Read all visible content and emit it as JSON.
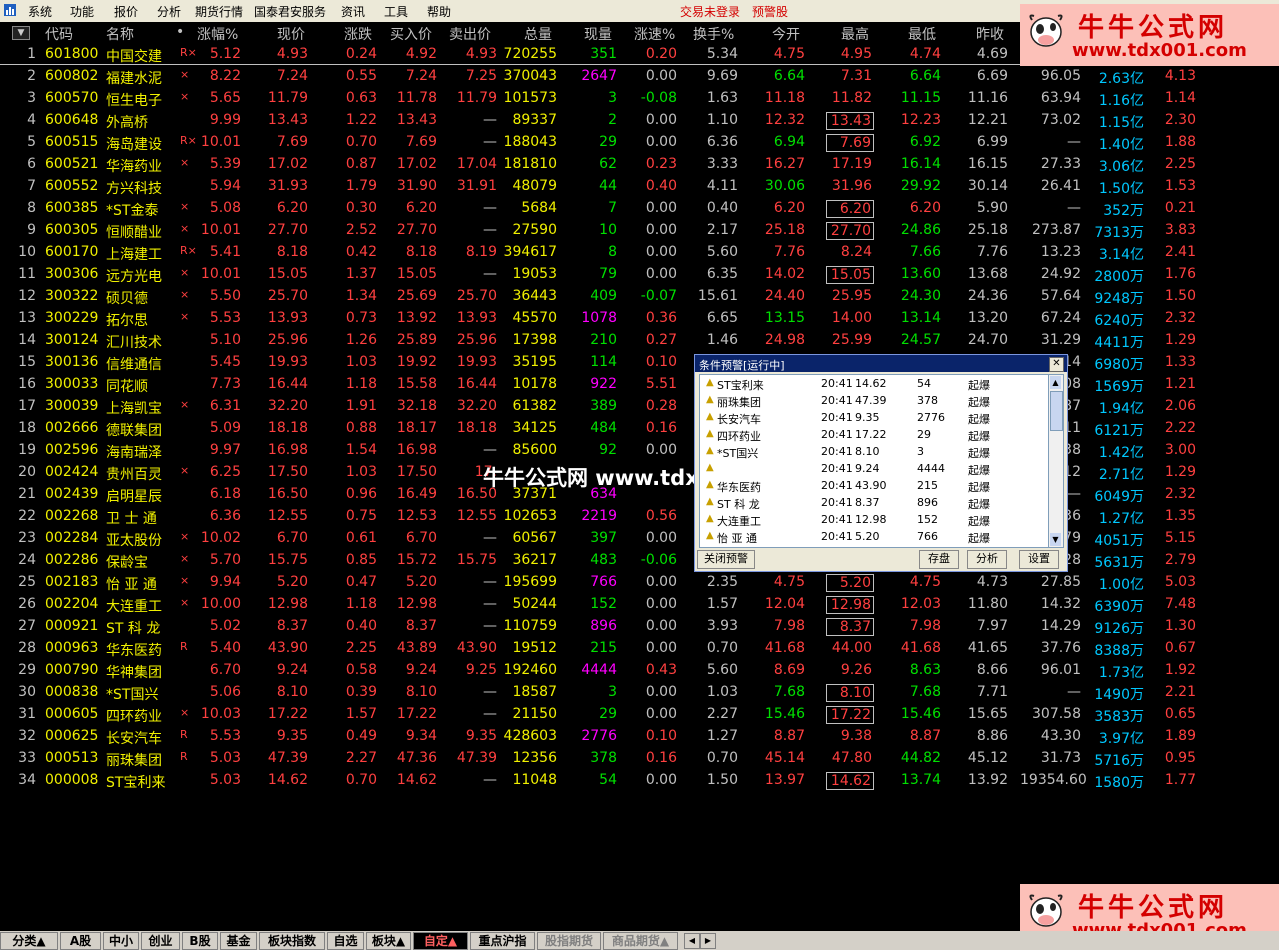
{
  "menu": {
    "items": [
      "系统",
      "功能",
      "报价",
      "分析",
      "期货行情",
      "国泰君安服务",
      "资讯",
      "工具",
      "帮助"
    ],
    "status": "交易未登录",
    "alert_stock": "预警股"
  },
  "header": [
    "代码",
    "名称",
    "•",
    "涨幅%",
    "现价",
    "涨跌",
    "买入价",
    "卖出价",
    "总量",
    "现量",
    "涨速%",
    "换手%",
    "今开",
    "最高",
    "最低",
    "昨收"
  ],
  "colors": {
    "up": "#ff4040",
    "down": "#00e000",
    "flat": "#c0c0c0",
    "code": "#f0f000",
    "name": "#f0f000",
    "vol": "#f0f000",
    "cur_up": "#ff00ff",
    "cur_down": "#00e000"
  },
  "rows": [
    {
      "n": "1",
      "code": "601800",
      "name": "中国交建",
      "flag": "R×",
      "pct": "5.12",
      "price": "4.93",
      "chg": "0.24",
      "bid": "4.92",
      "ask": "4.93",
      "vol": "720255",
      "cur": "351",
      "spd": "0.20",
      "turn": "5.34",
      "open": "4.75",
      "high": "4.95",
      "low": "4.74",
      "prev": "4.69",
      "e1": "",
      "e2": "",
      "e3": "",
      "hbox": false
    },
    {
      "n": "2",
      "code": "600802",
      "name": "福建水泥",
      "flag": "×",
      "pct": "8.22",
      "price": "7.24",
      "chg": "0.55",
      "bid": "7.24",
      "ask": "7.25",
      "vol": "370043",
      "cur": "2647",
      "spd": "0.00",
      "turn": "9.69",
      "open": "6.64",
      "high": "7.31",
      "low": "6.64",
      "prev": "6.69",
      "e1": "96.05",
      "e2": "2.63亿",
      "e3": "4.13",
      "hbox": false
    },
    {
      "n": "3",
      "code": "600570",
      "name": "恒生电子",
      "flag": "×",
      "pct": "5.65",
      "price": "11.79",
      "chg": "0.63",
      "bid": "11.78",
      "ask": "11.79",
      "vol": "101573",
      "cur": "3",
      "spd": "-0.08",
      "turn": "1.63",
      "open": "11.18",
      "high": "11.82",
      "low": "11.15",
      "prev": "11.16",
      "e1": "63.94",
      "e2": "1.16亿",
      "e3": "1.14",
      "hbox": false
    },
    {
      "n": "4",
      "code": "600648",
      "name": "外高桥",
      "flag": "",
      "pct": "9.99",
      "price": "13.43",
      "chg": "1.22",
      "bid": "13.43",
      "ask": "—",
      "vol": "89337",
      "cur": "2",
      "spd": "0.00",
      "turn": "1.10",
      "open": "12.32",
      "high": "13.43",
      "low": "12.23",
      "prev": "12.21",
      "e1": "73.02",
      "e2": "1.15亿",
      "e3": "2.30",
      "hbox": true
    },
    {
      "n": "5",
      "code": "600515",
      "name": "海岛建设",
      "flag": "R×",
      "pct": "10.01",
      "price": "7.69",
      "chg": "0.70",
      "bid": "7.69",
      "ask": "—",
      "vol": "188043",
      "cur": "29",
      "spd": "0.00",
      "turn": "6.36",
      "open": "6.94",
      "high": "7.69",
      "low": "6.92",
      "prev": "6.99",
      "e1": "—",
      "e2": "1.40亿",
      "e3": "1.88",
      "hbox": true
    },
    {
      "n": "6",
      "code": "600521",
      "name": "华海药业",
      "flag": "×",
      "pct": "5.39",
      "price": "17.02",
      "chg": "0.87",
      "bid": "17.02",
      "ask": "17.04",
      "vol": "181810",
      "cur": "62",
      "spd": "0.23",
      "turn": "3.33",
      "open": "16.27",
      "high": "17.19",
      "low": "16.14",
      "prev": "16.15",
      "e1": "27.33",
      "e2": "3.06亿",
      "e3": "2.25",
      "hbox": false
    },
    {
      "n": "7",
      "code": "600552",
      "name": "方兴科技",
      "flag": "",
      "pct": "5.94",
      "price": "31.93",
      "chg": "1.79",
      "bid": "31.90",
      "ask": "31.91",
      "vol": "48079",
      "cur": "44",
      "spd": "0.40",
      "turn": "4.11",
      "open": "30.06",
      "high": "31.96",
      "low": "29.92",
      "prev": "30.14",
      "e1": "26.41",
      "e2": "1.50亿",
      "e3": "1.53",
      "hbox": false
    },
    {
      "n": "8",
      "code": "600385",
      "name": "*ST金泰",
      "flag": "×",
      "pct": "5.08",
      "price": "6.20",
      "chg": "0.30",
      "bid": "6.20",
      "ask": "—",
      "vol": "5684",
      "cur": "7",
      "spd": "0.00",
      "turn": "0.40",
      "open": "6.20",
      "high": "6.20",
      "low": "6.20",
      "prev": "5.90",
      "e1": "—",
      "e2": "352万",
      "e3": "0.21",
      "hbox": true
    },
    {
      "n": "9",
      "code": "600305",
      "name": "恒顺醋业",
      "flag": "×",
      "pct": "10.01",
      "price": "27.70",
      "chg": "2.52",
      "bid": "27.70",
      "ask": "—",
      "vol": "27590",
      "cur": "10",
      "spd": "0.00",
      "turn": "2.17",
      "open": "25.18",
      "high": "27.70",
      "low": "24.86",
      "prev": "25.18",
      "e1": "273.87",
      "e2": "7313万",
      "e3": "3.83",
      "hbox": true
    },
    {
      "n": "10",
      "code": "600170",
      "name": "上海建工",
      "flag": "R×",
      "pct": "5.41",
      "price": "8.18",
      "chg": "0.42",
      "bid": "8.18",
      "ask": "8.19",
      "vol": "394617",
      "cur": "8",
      "spd": "0.00",
      "turn": "5.60",
      "open": "7.76",
      "high": "8.24",
      "low": "7.66",
      "prev": "7.76",
      "e1": "13.23",
      "e2": "3.14亿",
      "e3": "2.41",
      "hbox": false
    },
    {
      "n": "11",
      "code": "300306",
      "name": "远方光电",
      "flag": "×",
      "pct": "10.01",
      "price": "15.05",
      "chg": "1.37",
      "bid": "15.05",
      "ask": "—",
      "vol": "19053",
      "cur": "79",
      "spd": "0.00",
      "turn": "6.35",
      "open": "14.02",
      "high": "15.05",
      "low": "13.60",
      "prev": "13.68",
      "e1": "24.92",
      "e2": "2800万",
      "e3": "1.76",
      "hbox": true
    },
    {
      "n": "12",
      "code": "300322",
      "name": "硕贝德",
      "flag": "×",
      "pct": "5.50",
      "price": "25.70",
      "chg": "1.34",
      "bid": "25.69",
      "ask": "25.70",
      "vol": "36443",
      "cur": "409",
      "spd": "-0.07",
      "turn": "15.61",
      "open": "24.40",
      "high": "25.95",
      "low": "24.30",
      "prev": "24.36",
      "e1": "57.64",
      "e2": "9248万",
      "e3": "1.50",
      "hbox": false
    },
    {
      "n": "13",
      "code": "300229",
      "name": "拓尔思",
      "flag": "×",
      "pct": "5.53",
      "price": "13.93",
      "chg": "0.73",
      "bid": "13.92",
      "ask": "13.93",
      "vol": "45570",
      "cur": "1078",
      "spd": "0.36",
      "turn": "6.65",
      "open": "13.15",
      "high": "14.00",
      "low": "13.14",
      "prev": "13.20",
      "e1": "67.24",
      "e2": "6240万",
      "e3": "2.32",
      "hbox": false
    },
    {
      "n": "14",
      "code": "300124",
      "name": "汇川技术",
      "flag": "",
      "pct": "5.10",
      "price": "25.96",
      "chg": "1.26",
      "bid": "25.89",
      "ask": "25.96",
      "vol": "17398",
      "cur": "210",
      "spd": "0.27",
      "turn": "1.46",
      "open": "24.98",
      "high": "25.99",
      "low": "24.57",
      "prev": "24.70",
      "e1": "31.29",
      "e2": "4411万",
      "e3": "1.29",
      "hbox": false
    },
    {
      "n": "15",
      "code": "300136",
      "name": "信维通信",
      "flag": "",
      "pct": "5.45",
      "price": "19.93",
      "chg": "1.03",
      "bid": "19.92",
      "ask": "19.93",
      "vol": "35195",
      "cur": "114",
      "spd": "0.10",
      "turn": "",
      "open": "",
      "high": "",
      "low": "",
      "prev": "",
      "e1": "14",
      "e2": "6980万",
      "e3": "1.33",
      "hbox": false
    },
    {
      "n": "16",
      "code": "300033",
      "name": "同花顺",
      "flag": "",
      "pct": "7.73",
      "price": "16.44",
      "chg": "1.18",
      "bid": "15.58",
      "ask": "16.44",
      "vol": "10178",
      "cur": "922",
      "spd": "5.51",
      "turn": "",
      "open": "",
      "high": "",
      "low": "",
      "prev": "",
      "e1": "08",
      "e2": "1569万",
      "e3": "1.21",
      "hbox": false
    },
    {
      "n": "17",
      "code": "300039",
      "name": "上海凯宝",
      "flag": "×",
      "pct": "6.31",
      "price": "32.20",
      "chg": "1.91",
      "bid": "32.18",
      "ask": "32.20",
      "vol": "61382",
      "cur": "389",
      "spd": "0.28",
      "turn": "",
      "open": "",
      "high": "",
      "low": "",
      "prev": "",
      "e1": "87",
      "e2": "1.94亿",
      "e3": "2.06",
      "hbox": false
    },
    {
      "n": "18",
      "code": "002666",
      "name": "德联集团",
      "flag": "",
      "pct": "5.09",
      "price": "18.18",
      "chg": "0.88",
      "bid": "18.17",
      "ask": "18.18",
      "vol": "34125",
      "cur": "484",
      "spd": "0.16",
      "turn": "",
      "open": "",
      "high": "",
      "low": "",
      "prev": "",
      "e1": "11",
      "e2": "6121万",
      "e3": "2.22",
      "hbox": false
    },
    {
      "n": "19",
      "code": "002596",
      "name": "海南瑞泽",
      "flag": "",
      "pct": "9.97",
      "price": "16.98",
      "chg": "1.54",
      "bid": "16.98",
      "ask": "—",
      "vol": "85600",
      "cur": "92",
      "spd": "0.00",
      "turn": "",
      "open": "",
      "high": "",
      "low": "",
      "prev": "",
      "e1": "38",
      "e2": "1.42亿",
      "e3": "3.00",
      "hbox": false
    },
    {
      "n": "20",
      "code": "002424",
      "name": "贵州百灵",
      "flag": "×",
      "pct": "6.25",
      "price": "17.50",
      "chg": "1.03",
      "bid": "17.50",
      "ask": "17.",
      "vol": "",
      "cur": "",
      "spd": "",
      "turn": "",
      "open": "",
      "high": "",
      "low": "",
      "prev": "",
      "e1": "12",
      "e2": "2.71亿",
      "e3": "1.29",
      "hbox": false
    },
    {
      "n": "21",
      "code": "002439",
      "name": "启明星辰",
      "flag": "",
      "pct": "6.18",
      "price": "16.50",
      "chg": "0.96",
      "bid": "16.49",
      "ask": "16.50",
      "vol": "37371",
      "cur": "634",
      "spd": "",
      "turn": "",
      "open": "",
      "high": "",
      "low": "",
      "prev": "",
      "e1": "—",
      "e2": "6049万",
      "e3": "2.32",
      "hbox": false
    },
    {
      "n": "22",
      "code": "002268",
      "name": "卫 士 通",
      "flag": "",
      "pct": "6.36",
      "price": "12.55",
      "chg": "0.75",
      "bid": "12.53",
      "ask": "12.55",
      "vol": "102653",
      "cur": "2219",
      "spd": "0.56",
      "turn": "",
      "open": "",
      "high": "",
      "low": "",
      "prev": "",
      "e1": "36",
      "e2": "1.27亿",
      "e3": "1.35",
      "hbox": false
    },
    {
      "n": "23",
      "code": "002284",
      "name": "亚太股份",
      "flag": "×",
      "pct": "10.02",
      "price": "6.70",
      "chg": "0.61",
      "bid": "6.70",
      "ask": "—",
      "vol": "60567",
      "cur": "397",
      "spd": "0.00",
      "turn": "",
      "open": "",
      "high": "",
      "low": "",
      "prev": "",
      "e1": "79",
      "e2": "4051万",
      "e3": "5.15",
      "hbox": false
    },
    {
      "n": "24",
      "code": "002286",
      "name": "保龄宝",
      "flag": "×",
      "pct": "5.70",
      "price": "15.75",
      "chg": "0.85",
      "bid": "15.72",
      "ask": "15.75",
      "vol": "36217",
      "cur": "483",
      "spd": "-0.06",
      "turn": "",
      "open": "",
      "high": "",
      "low": "",
      "prev": "",
      "e1": "28",
      "e2": "5631万",
      "e3": "2.79",
      "hbox": false
    },
    {
      "n": "25",
      "code": "002183",
      "name": "怡 亚 通",
      "flag": "×",
      "pct": "9.94",
      "price": "5.20",
      "chg": "0.47",
      "bid": "5.20",
      "ask": "—",
      "vol": "195699",
      "cur": "766",
      "spd": "0.00",
      "turn": "2.35",
      "open": "4.75",
      "high": "5.20",
      "low": "4.75",
      "prev": "4.73",
      "e1": "27.85",
      "e2": "1.00亿",
      "e3": "5.03",
      "hbox": true
    },
    {
      "n": "26",
      "code": "002204",
      "name": "大连重工",
      "flag": "×",
      "pct": "10.00",
      "price": "12.98",
      "chg": "1.18",
      "bid": "12.98",
      "ask": "—",
      "vol": "50244",
      "cur": "152",
      "spd": "0.00",
      "turn": "1.57",
      "open": "12.04",
      "high": "12.98",
      "low": "12.03",
      "prev": "11.80",
      "e1": "14.32",
      "e2": "6390万",
      "e3": "7.48",
      "hbox": true
    },
    {
      "n": "27",
      "code": "000921",
      "name": "ST 科 龙",
      "flag": "",
      "pct": "5.02",
      "price": "8.37",
      "chg": "0.40",
      "bid": "8.37",
      "ask": "—",
      "vol": "110759",
      "cur": "896",
      "spd": "0.00",
      "turn": "3.93",
      "open": "7.98",
      "high": "8.37",
      "low": "7.98",
      "prev": "7.97",
      "e1": "14.29",
      "e2": "9126万",
      "e3": "1.30",
      "hbox": true
    },
    {
      "n": "28",
      "code": "000963",
      "name": "华东医药",
      "flag": "R",
      "pct": "5.40",
      "price": "43.90",
      "chg": "2.25",
      "bid": "43.89",
      "ask": "43.90",
      "vol": "19512",
      "cur": "215",
      "spd": "0.00",
      "turn": "0.70",
      "open": "41.68",
      "high": "44.00",
      "low": "41.68",
      "prev": "41.65",
      "e1": "37.76",
      "e2": "8388万",
      "e3": "0.67",
      "hbox": false
    },
    {
      "n": "29",
      "code": "000790",
      "name": "华神集团",
      "flag": "",
      "pct": "6.70",
      "price": "9.24",
      "chg": "0.58",
      "bid": "9.24",
      "ask": "9.25",
      "vol": "192460",
      "cur": "4444",
      "spd": "0.43",
      "turn": "5.60",
      "open": "8.69",
      "high": "9.26",
      "low": "8.63",
      "prev": "8.66",
      "e1": "96.01",
      "e2": "1.73亿",
      "e3": "1.92",
      "hbox": false
    },
    {
      "n": "30",
      "code": "000838",
      "name": "*ST国兴",
      "flag": "",
      "pct": "5.06",
      "price": "8.10",
      "chg": "0.39",
      "bid": "8.10",
      "ask": "—",
      "vol": "18587",
      "cur": "3",
      "spd": "0.00",
      "turn": "1.03",
      "open": "7.68",
      "high": "8.10",
      "low": "7.68",
      "prev": "7.71",
      "e1": "—",
      "e2": "1490万",
      "e3": "2.21",
      "hbox": true
    },
    {
      "n": "31",
      "code": "000605",
      "name": "四环药业",
      "flag": "×",
      "pct": "10.03",
      "price": "17.22",
      "chg": "1.57",
      "bid": "17.22",
      "ask": "—",
      "vol": "21150",
      "cur": "29",
      "spd": "0.00",
      "turn": "2.27",
      "open": "15.46",
      "high": "17.22",
      "low": "15.46",
      "prev": "15.65",
      "e1": "307.58",
      "e2": "3583万",
      "e3": "0.65",
      "hbox": true
    },
    {
      "n": "32",
      "code": "000625",
      "name": "长安汽车",
      "flag": "R",
      "pct": "5.53",
      "price": "9.35",
      "chg": "0.49",
      "bid": "9.34",
      "ask": "9.35",
      "vol": "428603",
      "cur": "2776",
      "spd": "0.10",
      "turn": "1.27",
      "open": "8.87",
      "high": "9.38",
      "low": "8.87",
      "prev": "8.86",
      "e1": "43.30",
      "e2": "3.97亿",
      "e3": "1.89",
      "hbox": false
    },
    {
      "n": "33",
      "code": "000513",
      "name": "丽珠集团",
      "flag": "R",
      "pct": "5.03",
      "price": "47.39",
      "chg": "2.27",
      "bid": "47.36",
      "ask": "47.39",
      "vol": "12356",
      "cur": "378",
      "spd": "0.16",
      "turn": "0.70",
      "open": "45.14",
      "high": "47.80",
      "low": "44.82",
      "prev": "45.12",
      "e1": "31.73",
      "e2": "5716万",
      "e3": "0.95",
      "hbox": false
    },
    {
      "n": "34",
      "code": "000008",
      "name": "ST宝利来",
      "flag": "",
      "pct": "5.03",
      "price": "14.62",
      "chg": "0.70",
      "bid": "14.62",
      "ask": "—",
      "vol": "11048",
      "cur": "54",
      "spd": "0.00",
      "turn": "1.50",
      "open": "13.97",
      "high": "14.62",
      "low": "13.74",
      "prev": "13.92",
      "e1": "19354.60",
      "e2": "1580万",
      "e3": "1.77",
      "hbox": true
    }
  ],
  "logo": {
    "t1": "牛牛公式网",
    "t2": "www.tdx001.com"
  },
  "watermark": "牛牛公式网 www.tdx001.com",
  "alert": {
    "title": "条件预警[运行中]",
    "rows": [
      {
        "name": "ST宝利来",
        "time": "20:41",
        "price": "14.62",
        "vol": "54",
        "type": "起爆"
      },
      {
        "name": "丽珠集团",
        "time": "20:41",
        "price": "47.39",
        "vol": "378",
        "type": "起爆"
      },
      {
        "name": "长安汽车",
        "time": "20:41",
        "price": "9.35",
        "vol": "2776",
        "type": "起爆"
      },
      {
        "name": "四环药业",
        "time": "20:41",
        "price": "17.22",
        "vol": "29",
        "type": "起爆"
      },
      {
        "name": "*ST国兴",
        "time": "20:41",
        "price": "8.10",
        "vol": "3",
        "type": "起爆"
      },
      {
        "name": "",
        "time": "20:41",
        "price": "9.24",
        "vol": "4444",
        "type": "起爆"
      },
      {
        "name": "华东医药",
        "time": "20:41",
        "price": "43.90",
        "vol": "215",
        "type": "起爆"
      },
      {
        "name": "ST 科 龙",
        "time": "20:41",
        "price": "8.37",
        "vol": "896",
        "type": "起爆"
      },
      {
        "name": "大连重工",
        "time": "20:41",
        "price": "12.98",
        "vol": "152",
        "type": "起爆"
      },
      {
        "name": "怡 亚 通",
        "time": "20:41",
        "price": "5.20",
        "vol": "766",
        "type": "起爆"
      }
    ],
    "btn_close": "关闭预警",
    "btn_save": "存盘",
    "btn_analyze": "分析",
    "btn_settings": "设置"
  },
  "tabs": [
    {
      "label": "分类▲",
      "active": false,
      "dim": false
    },
    {
      "label": "A股",
      "active": false,
      "dim": false
    },
    {
      "label": "中小",
      "active": false,
      "dim": false
    },
    {
      "label": "创业",
      "active": false,
      "dim": false
    },
    {
      "label": "B股",
      "active": false,
      "dim": false
    },
    {
      "label": "基金",
      "active": false,
      "dim": false
    },
    {
      "label": "板块指数",
      "active": false,
      "dim": false
    },
    {
      "label": "自选",
      "active": false,
      "dim": false
    },
    {
      "label": "板块▲",
      "active": false,
      "dim": false
    },
    {
      "label": "自定▲",
      "active": true,
      "dim": false
    },
    {
      "label": "重点沪指",
      "active": false,
      "dim": false
    },
    {
      "label": "股指期货",
      "active": false,
      "dim": true
    },
    {
      "label": "商品期货▲",
      "active": false,
      "dim": true
    }
  ]
}
